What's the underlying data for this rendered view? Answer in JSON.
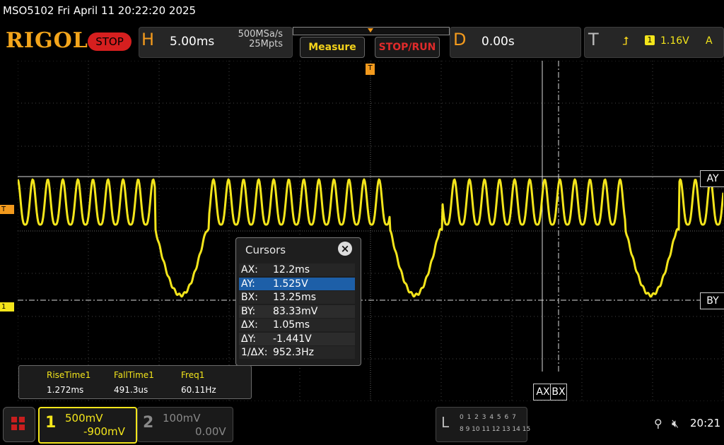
{
  "window": {
    "title": "MSO5102  Fri April 11 20:22:20 2025"
  },
  "toolbar": {
    "logo": "RIGOL",
    "status": "STOP",
    "horizontal": {
      "letter": "H",
      "timebase": "5.00ms",
      "sample_rate": "500MSa/s",
      "memory_depth": "25Mpts"
    },
    "measure_label": "Measure",
    "stop_run_label": "STOP/RUN",
    "delay": {
      "letter": "D",
      "value": "0.00s"
    },
    "trigger": {
      "letter": "T",
      "source": "1",
      "level": "1.16V",
      "mode": "A"
    }
  },
  "markers": {
    "trigger_level": "T",
    "ch1_ground": "1",
    "cursor_ay": "AY",
    "cursor_by": "BY",
    "cursor_ax": "AX",
    "cursor_bx": "BX"
  },
  "cursors_panel": {
    "title": "Cursors",
    "rows": [
      {
        "key": "AX:",
        "value": "12.2ms"
      },
      {
        "key": "AY:",
        "value": "1.525V"
      },
      {
        "key": "BX:",
        "value": "13.25ms"
      },
      {
        "key": "BY:",
        "value": "83.33mV"
      },
      {
        "key": "ΔX:",
        "value": "1.05ms"
      },
      {
        "key": "ΔY:",
        "value": "-1.441V"
      },
      {
        "key": "1/ΔX:",
        "value": "952.3Hz"
      }
    ],
    "selected_row": 1
  },
  "measurements": [
    {
      "name": "RiseTime1",
      "value": "1.272ms"
    },
    {
      "name": "FallTime1",
      "value": "491.3us"
    },
    {
      "name": "Freq1",
      "value": "60.11Hz"
    }
  ],
  "channels": {
    "ch1": {
      "number": "1",
      "scale": "500mV",
      "offset": "-900mV",
      "color": "#f3e51b"
    },
    "ch2": {
      "number": "2",
      "scale": "100mV",
      "offset": "0.00V",
      "color": "#888888"
    }
  },
  "logic": {
    "letter": "L",
    "row1": "0 1 2 3  4 5 6 7",
    "row2": "8 9 10 11 12 13 14 15"
  },
  "status": {
    "clock": "20:21"
  },
  "colors": {
    "trace": "#f3e51b",
    "accent": "#f39a1d",
    "stop": "#d61f1f"
  }
}
